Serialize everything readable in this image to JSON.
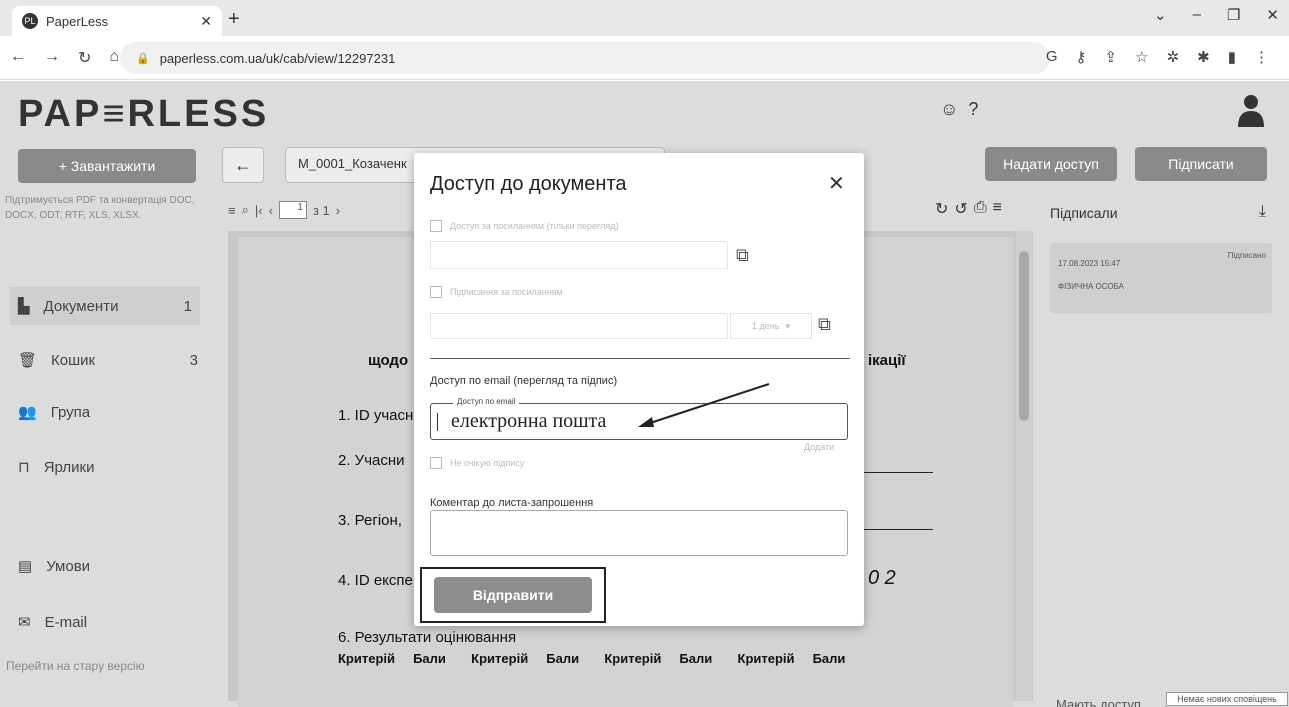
{
  "browser": {
    "tab_title": "PaperLess",
    "favicon": "PL",
    "url": "paperless.com.ua/uk/cab/view/12297231"
  },
  "app": {
    "logo": "PAP≡RLESS",
    "upload_label": "+ Завантажити",
    "support_text": "Підтримується PDF та конвертація DOC, DOCX, ODT, RTF, XLS, XLSX.",
    "sidebar": [
      {
        "label": "Документи",
        "count": "1",
        "icon": "document-icon"
      },
      {
        "label": "Кошик",
        "count": "3",
        "icon": "trash-icon"
      },
      {
        "label": "Група",
        "count": "",
        "icon": "group-icon"
      },
      {
        "label": "Ярлики",
        "count": "",
        "icon": "bookmark-icon"
      },
      {
        "label": "Умови",
        "count": "",
        "icon": "terms-icon"
      },
      {
        "label": "E-mail",
        "count": "",
        "icon": "mail-icon"
      }
    ],
    "old_version_link": "Перейти на стару версію",
    "doc_name": "M_0001_Козаченк",
    "share_button": "Надати доступ",
    "sign_button": "Підписати",
    "page_number": "1",
    "page_total": "з 1",
    "doc_lines": {
      "heading_left": "щодо",
      "heading_right": "ікації",
      "line1": "1. ID учасн",
      "line2": "2. Учасни",
      "line3": "3. Регіон, ",
      "line4": "4. ID експе",
      "line4_digits": "0 2",
      "line6": "6. Результати оцінювання",
      "criteria_header": "Критерій     Бали       Критерій     Бали       Критерій     Бали       Критерій     Бали"
    },
    "signers": {
      "title": "Підписали",
      "date": "17.08.2023 15:47",
      "status": "Підписано",
      "type": "ФІЗИЧНА ОСОБА",
      "have_access": "Мають доступ"
    },
    "notification": "Немає нових сповіщень"
  },
  "modal": {
    "title": "Доступ до документа",
    "link_access_label": "Доступ за посиланням (тільки перегляд)",
    "sign_link_label": "Підписання за посиланням",
    "day_select": "1 день",
    "email_section": "Доступ по email (перегляд та підпис)",
    "email_legend": "Доступ по email",
    "email_value": "електронна пошта",
    "add_label": "Додати",
    "no_sign_label": "Не очікую підпису",
    "comment_label": "Коментар до листа-запрошення",
    "send_button": "Відправити"
  }
}
